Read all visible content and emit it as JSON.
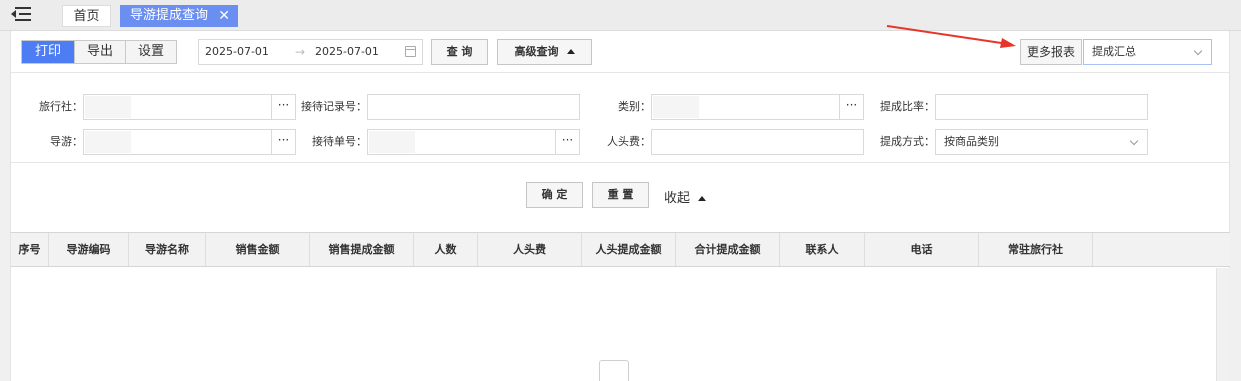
{
  "topbar": {
    "tabs": [
      {
        "label": "首页"
      },
      {
        "label": "导游提成查询"
      }
    ],
    "close_glyph": "✕"
  },
  "toolbar": {
    "print_label": "打印",
    "export_label": "导出",
    "settings_label": "设置",
    "date_start": "2025-07-01",
    "date_sep": "→",
    "date_end": "2025-07-01",
    "query_label": "查 询",
    "advanced_label": "高级查询",
    "more_reports_label": "更多报表",
    "report_select_value": "提成汇总"
  },
  "filters": {
    "agency_label": "旅行社：",
    "guide_label": "导游：",
    "reception_record_label": "接待记录号：",
    "reception_order_label": "接待单号：",
    "category_label": "类别：",
    "per_head_fee_label": "人头费：",
    "commission_rate_label": "提成比率：",
    "commission_method_label": "提成方式：",
    "commission_method_value": "按商品类别",
    "lookup_glyph": "···"
  },
  "actions": {
    "confirm_label": "确 定",
    "reset_label": "重 置",
    "collapse_label": "收起"
  },
  "table": {
    "columns": [
      "序号",
      "导游编码",
      "导游名称",
      "销售金额",
      "销售提成金额",
      "人数",
      "人头费",
      "人头提成金额",
      "合计提成金额",
      "联系人",
      "电话",
      "常驻旅行社"
    ]
  },
  "colors": {
    "primary": "#4d7cf3",
    "active_tab": "#6b8ff0",
    "annotation_arrow": "#e8352a"
  },
  "icons": {
    "menu_toggle": "menu-collapse-icon",
    "calendar": "calendar-icon",
    "chevron": "chevron-down-icon",
    "empty": "empty-box-icon"
  }
}
